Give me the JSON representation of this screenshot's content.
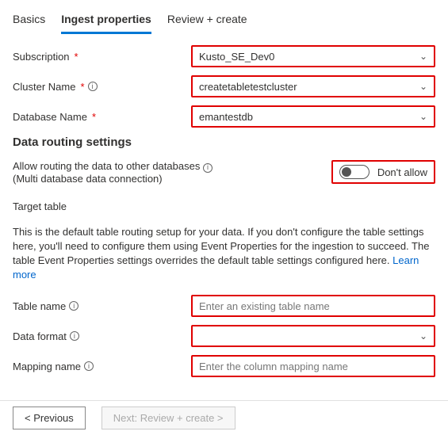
{
  "tabs": {
    "basics": "Basics",
    "ingest": "Ingest properties",
    "review": "Review + create"
  },
  "fields": {
    "subscription": {
      "label": "Subscription",
      "value": "Kusto_SE_Dev0"
    },
    "cluster": {
      "label": "Cluster Name",
      "value": "createtabletestcluster"
    },
    "database": {
      "label": "Database Name",
      "value": "emantestdb"
    },
    "table": {
      "label": "Table name",
      "placeholder": "Enter an existing table name"
    },
    "format": {
      "label": "Data format",
      "value": ""
    },
    "mapping": {
      "label": "Mapping name",
      "placeholder": "Enter the column mapping name"
    }
  },
  "sections": {
    "routing": "Data routing settings",
    "routing_text": "Allow routing the data to other databases",
    "routing_sub": "(Multi database data connection)",
    "toggle_state": "Don't allow",
    "target": "Target table",
    "desc_a": "This is the default table routing setup for your data. If you don't configure the table settings here, you'll need to configure them using Event Properties for the ingestion to succeed. The table Event Properties settings overrides the default table settings configured here. ",
    "desc_link": "Learn more"
  },
  "buttons": {
    "prev": "<  Previous",
    "next": "Next: Review + create >"
  }
}
